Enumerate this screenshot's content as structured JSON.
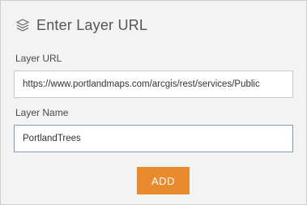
{
  "dialog": {
    "title": "Enter Layer URL",
    "icon": "layers-icon"
  },
  "layer_url": {
    "label": "Layer URL",
    "value": "https://www.portlandmaps.com/arcgis/rest/services/Public"
  },
  "layer_name": {
    "label": "Layer Name",
    "value": "PortlandTrees"
  },
  "actions": {
    "add_label": "ADD"
  },
  "colors": {
    "panel_background": "#f3f3f3",
    "add_button": "#e98a2e",
    "focused_border": "#7f9bc2"
  }
}
